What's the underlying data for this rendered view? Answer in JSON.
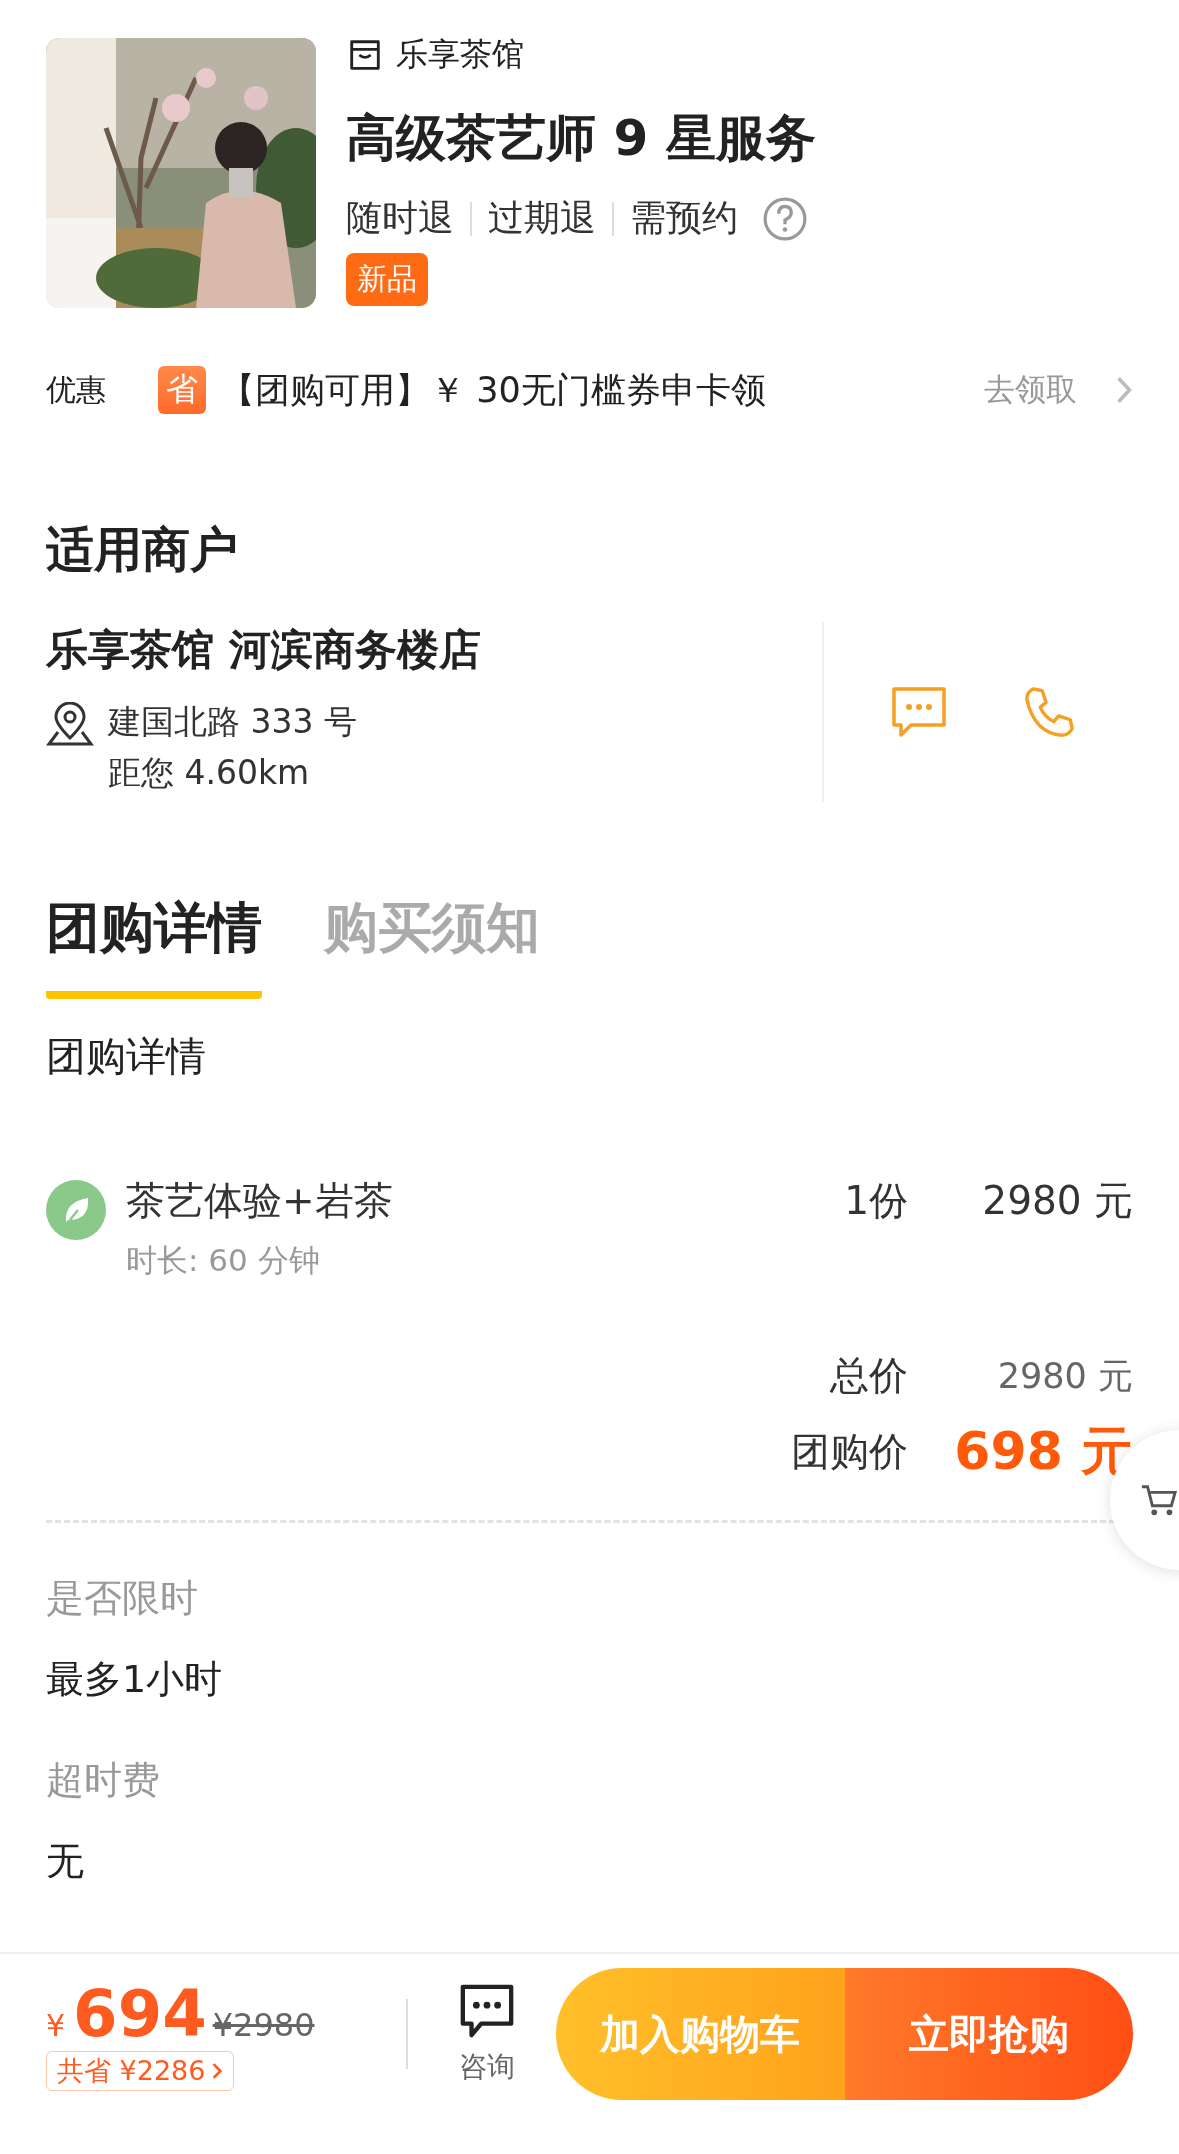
{
  "product": {
    "shop": "乐享茶馆",
    "title": "高级茶艺师 9 星服务",
    "tags": [
      "随时退",
      "过期退",
      "需预约"
    ],
    "badge": "新品"
  },
  "promo": {
    "label": "优惠",
    "icon_text": "省",
    "text": "【团购可用】￥ 30无门槛券申卡领",
    "action": "去领取"
  },
  "merchant": {
    "heading": "适用商户",
    "name": "乐享茶馆 河滨商务楼店",
    "address": "建国北路 333 号",
    "distance": "距您 4.60km"
  },
  "tabs": [
    {
      "label": "团购详情",
      "selected": true
    },
    {
      "label": "购买须知",
      "selected": false
    }
  ],
  "details": {
    "heading": "团购详情",
    "items": [
      {
        "name": "茶艺体验+岩茶",
        "duration": "时长: 60 分钟",
        "quantity": "1份",
        "price": "2980 元"
      }
    ],
    "total_label": "总价",
    "total": "2980 元",
    "group_label": "团购价",
    "group_price": "698 元"
  },
  "notes": [
    {
      "label": "是否限时",
      "value": "最多1小时"
    },
    {
      "label": "超时费",
      "value": "无"
    }
  ],
  "bottom_bar": {
    "currency": "¥",
    "price": "694",
    "original": "¥2980",
    "savings": "共省 ¥2286",
    "consult": "咨询",
    "add_to_cart": "加入购物车",
    "buy_now": "立即抢购"
  }
}
